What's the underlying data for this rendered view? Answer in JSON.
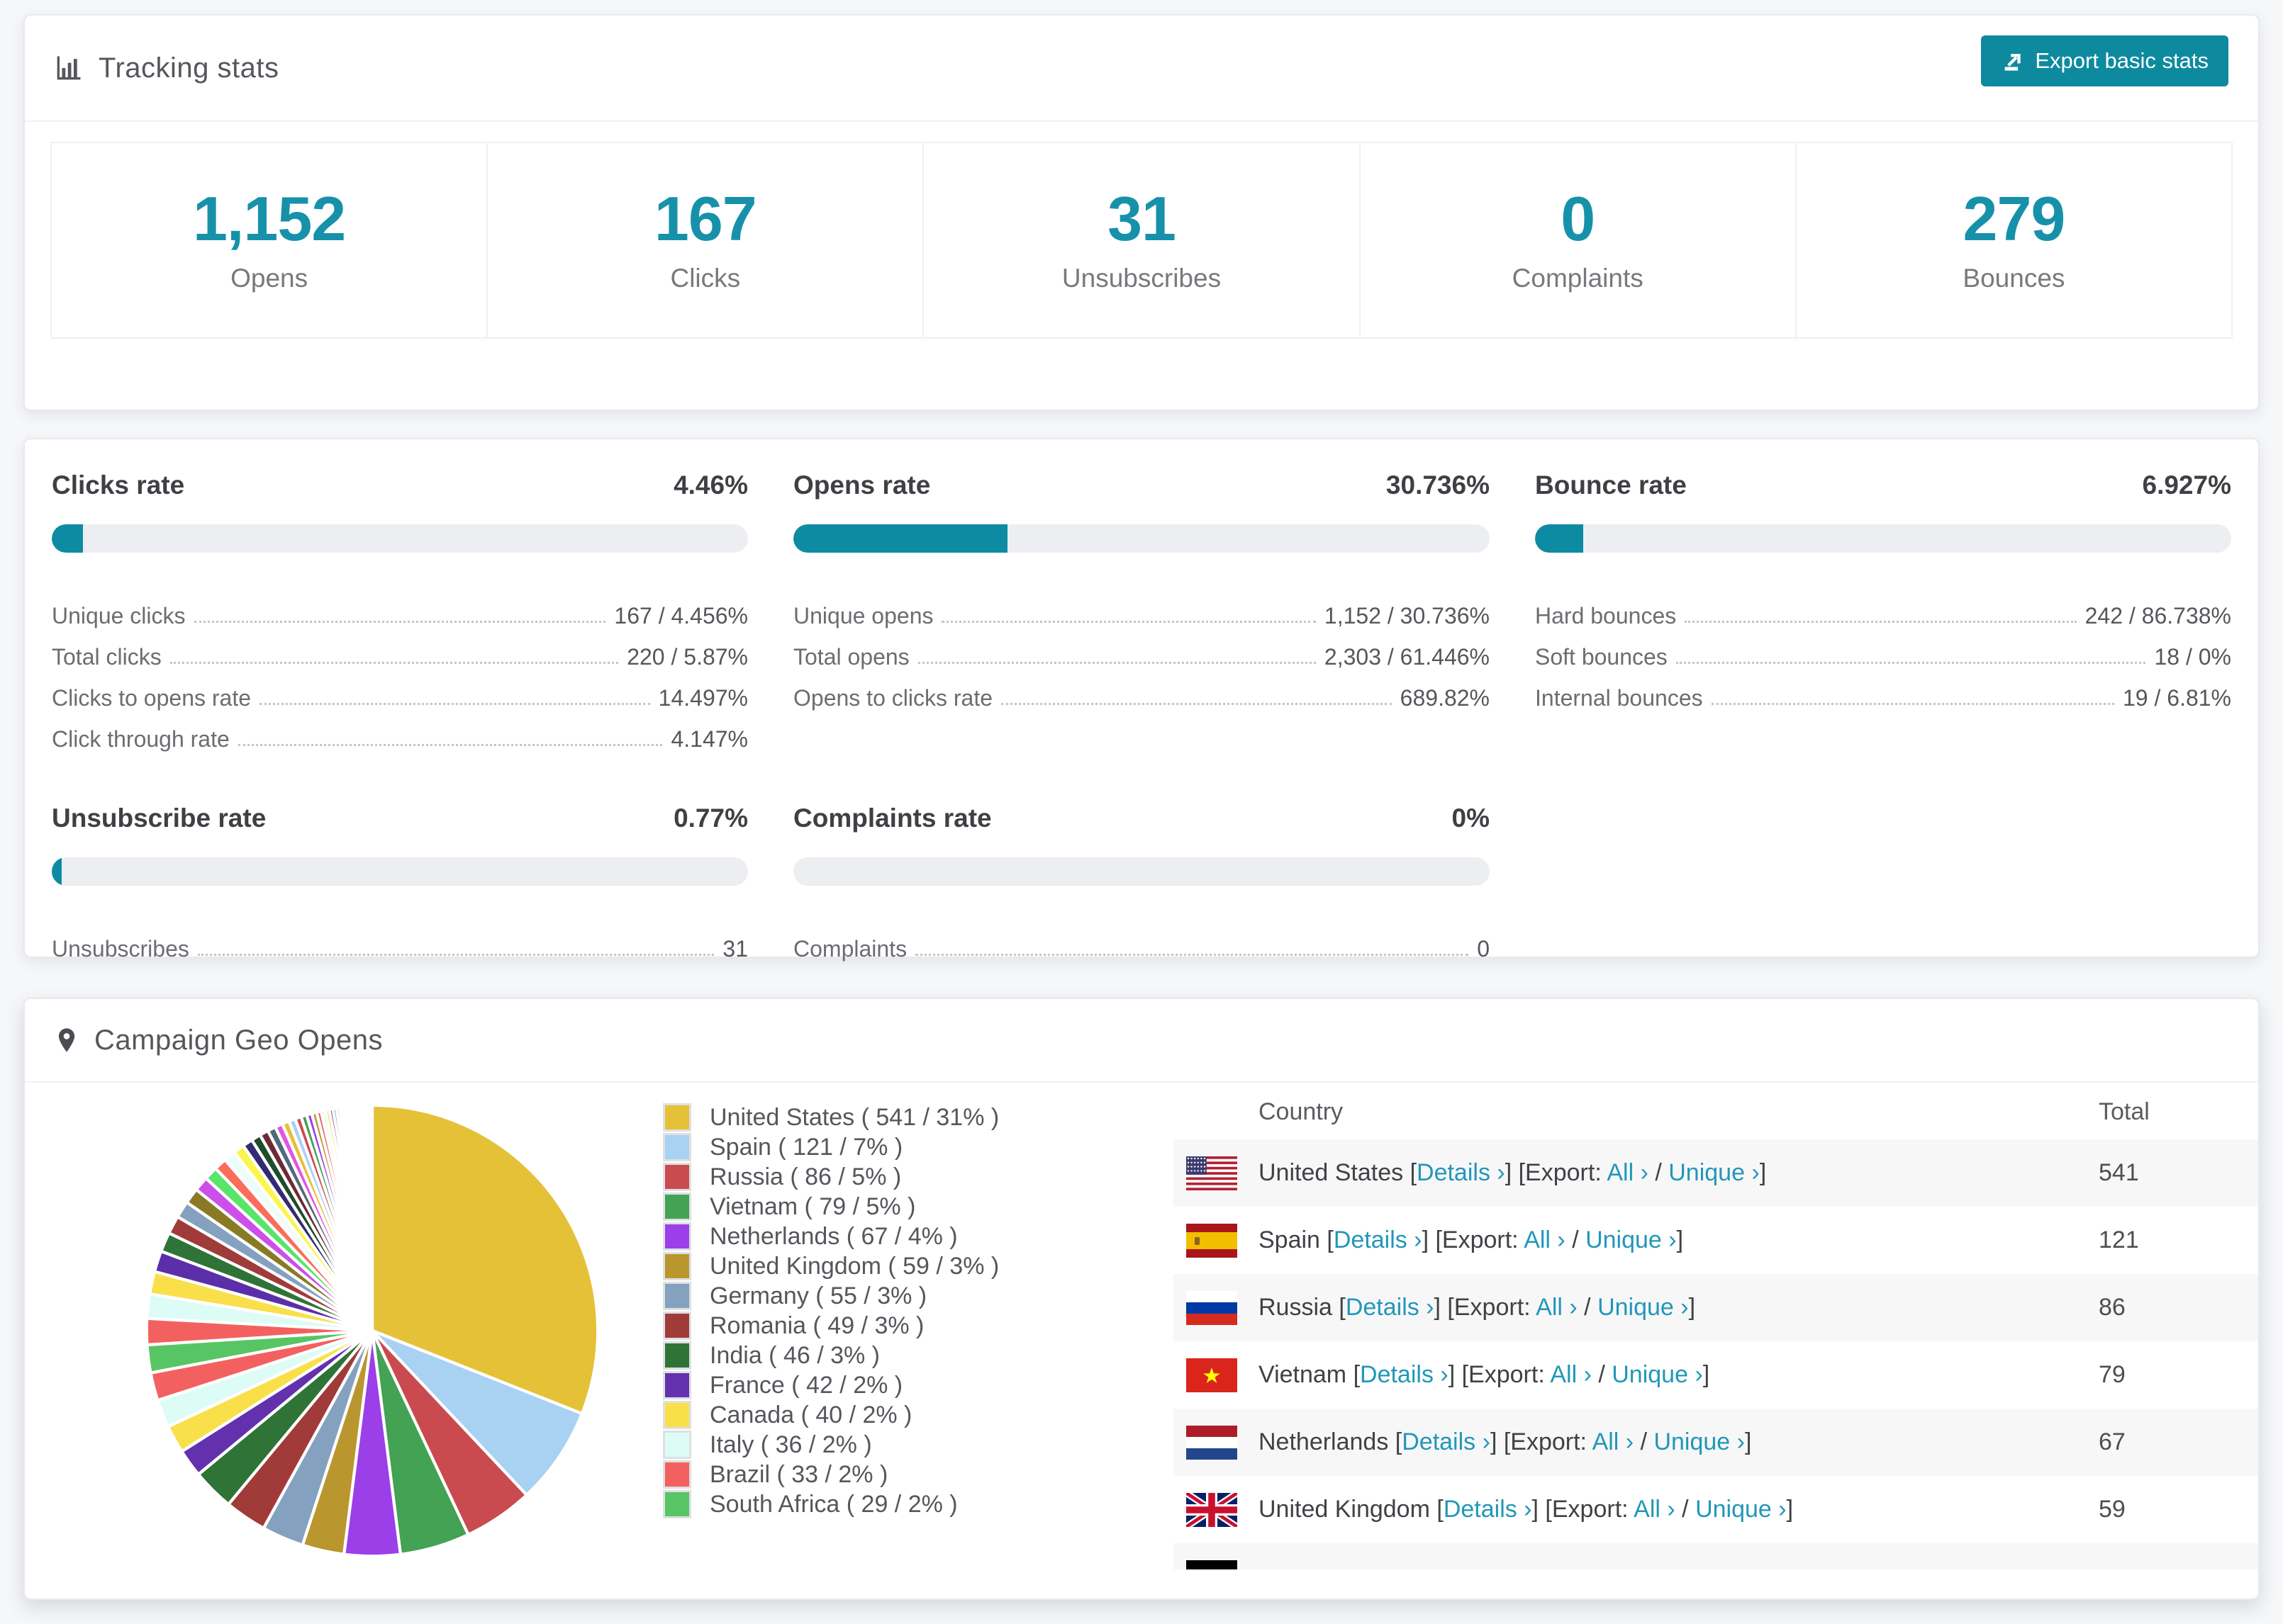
{
  "colors": {
    "accent": "#0d8ba2",
    "number": "#1791aa",
    "link": "#2197b9",
    "page_bg": "#f6f7f9",
    "bar_track": "#eceef2",
    "row_stripe": "#f7f7f8"
  },
  "tracking": {
    "title": "Tracking stats",
    "export_label": "Export basic stats",
    "stats": [
      {
        "value": "1,152",
        "label": "Opens"
      },
      {
        "value": "167",
        "label": "Clicks"
      },
      {
        "value": "31",
        "label": "Unsubscribes"
      },
      {
        "value": "0",
        "label": "Complaints"
      },
      {
        "value": "279",
        "label": "Bounces"
      }
    ]
  },
  "rates": {
    "row1": [
      {
        "title": "Clicks rate",
        "value": "4.46%",
        "bar_pct": 4.46,
        "rows": [
          {
            "label": "Unique clicks",
            "value": "167 / 4.456%"
          },
          {
            "label": "Total clicks",
            "value": "220 / 5.87%"
          },
          {
            "label": "Clicks to opens rate",
            "value": "14.497%"
          },
          {
            "label": "Click through rate",
            "value": "4.147%"
          }
        ]
      },
      {
        "title": "Opens rate",
        "value": "30.736%",
        "bar_pct": 30.736,
        "rows": [
          {
            "label": "Unique opens",
            "value": "1,152 / 30.736%"
          },
          {
            "label": "Total opens",
            "value": "2,303 / 61.446%"
          },
          {
            "label": "Opens to clicks rate",
            "value": "689.82%"
          }
        ]
      },
      {
        "title": "Bounce rate",
        "value": "6.927%",
        "bar_pct": 6.927,
        "rows": [
          {
            "label": "Hard bounces",
            "value": "242 / 86.738%"
          },
          {
            "label": "Soft bounces",
            "value": "18 / 0%"
          },
          {
            "label": "Internal bounces",
            "value": "19 / 6.81%"
          }
        ]
      }
    ],
    "row2": [
      {
        "title": "Unsubscribe rate",
        "value": "0.77%",
        "bar_pct": 0.77,
        "rows": [
          {
            "label": "Unsubscribes",
            "value": "31"
          }
        ]
      },
      {
        "title": "Complaints rate",
        "value": "0%",
        "bar_pct": 0,
        "rows": [
          {
            "label": "Complaints",
            "value": "0"
          }
        ]
      }
    ]
  },
  "geo": {
    "title": "Campaign Geo Opens",
    "table": {
      "columns": [
        "Country",
        "Total"
      ],
      "links": {
        "details": "Details ›",
        "export_prefix": "Export:",
        "all": "All ›",
        "slash": "/",
        "unique": "Unique ›"
      },
      "rows": [
        {
          "flag": "us",
          "country": "United States",
          "total": "541"
        },
        {
          "flag": "es",
          "country": "Spain",
          "total": "121"
        },
        {
          "flag": "ru",
          "country": "Russia",
          "total": "86"
        },
        {
          "flag": "vn",
          "country": "Vietnam",
          "total": "79"
        },
        {
          "flag": "nl",
          "country": "Netherlands",
          "total": "67"
        },
        {
          "flag": "gb",
          "country": "United Kingdom",
          "total": "59"
        },
        {
          "flag": "de",
          "country": "",
          "total": ""
        }
      ]
    }
  },
  "chart_data": {
    "type": "pie",
    "title": "Campaign Geo Opens",
    "legend_position": "right",
    "series": [
      {
        "name": "United States",
        "value": 541,
        "pct": 31,
        "color": "#e5c138",
        "label": "United States ( 541 / 31% )"
      },
      {
        "name": "Spain",
        "value": 121,
        "pct": 7,
        "color": "#a8d1f2",
        "label": "Spain ( 121 / 7% )"
      },
      {
        "name": "Russia",
        "value": 86,
        "pct": 5,
        "color": "#c94a4f",
        "label": "Russia ( 86 / 5% )"
      },
      {
        "name": "Vietnam",
        "value": 79,
        "pct": 5,
        "color": "#43a253",
        "label": "Vietnam ( 79 / 5% )"
      },
      {
        "name": "Netherlands",
        "value": 67,
        "pct": 4,
        "color": "#9b3fe8",
        "label": "Netherlands ( 67 / 4% )"
      },
      {
        "name": "United Kingdom",
        "value": 59,
        "pct": 3,
        "color": "#ba962f",
        "label": "United Kingdom ( 59 / 3% )"
      },
      {
        "name": "Germany",
        "value": 55,
        "pct": 3,
        "color": "#84a2bf",
        "label": "Germany ( 55 / 3% )"
      },
      {
        "name": "Romania",
        "value": 49,
        "pct": 3,
        "color": "#a03b3a",
        "label": "Romania ( 49 / 3% )"
      },
      {
        "name": "India",
        "value": 46,
        "pct": 3,
        "color": "#2f7436",
        "label": "India ( 46 / 3% )"
      },
      {
        "name": "France",
        "value": 42,
        "pct": 2,
        "color": "#6331ae",
        "label": "France ( 42 / 2% )"
      },
      {
        "name": "Canada",
        "value": 40,
        "pct": 2,
        "color": "#f9e04b",
        "label": "Canada ( 40 / 2% )"
      },
      {
        "name": "Italy",
        "value": 36,
        "pct": 2,
        "color": "#defcf6",
        "label": "Italy ( 36 / 2% )"
      },
      {
        "name": "Brazil",
        "value": 33,
        "pct": 2,
        "color": "#f2615f",
        "label": "Brazil ( 33 / 2% )"
      },
      {
        "name": "South Africa",
        "value": 29,
        "pct": 2,
        "color": "#58c565",
        "label": "South Africa ( 29 / 2% )"
      }
    ],
    "others": {
      "pct": 26,
      "slice_count": 50,
      "decay": 0.93
    },
    "tail_palette": [
      "#f2615f",
      "#defcf6",
      "#f9e04b",
      "#5b2fa8",
      "#2f7436",
      "#a03b3a",
      "#84a2bf",
      "#8a7a25",
      "#cb4fe8",
      "#58e56a",
      "#fb6c5b",
      "#eefcfa",
      "#fcf54d",
      "#342a72",
      "#1e4d2b",
      "#6e2a33",
      "#53687d",
      "#e455e0",
      "#e5c138",
      "#a8d1f2",
      "#c94a4f",
      "#43a253",
      "#9b3fe8",
      "#ba962f"
    ]
  }
}
